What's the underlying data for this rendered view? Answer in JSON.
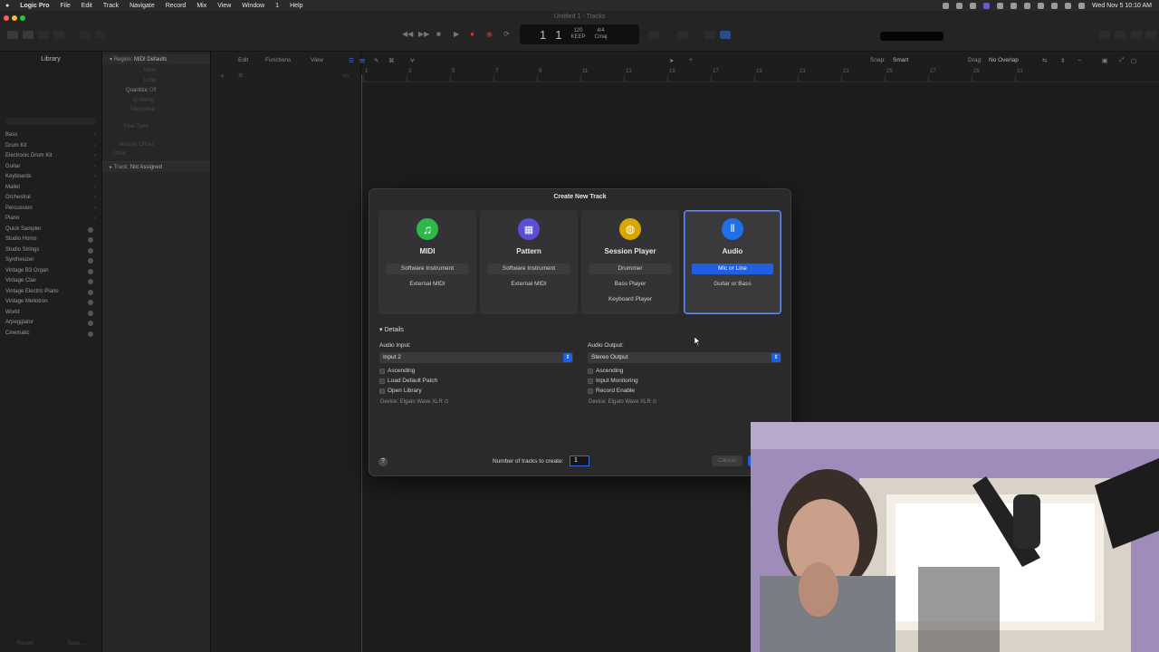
{
  "menubar": {
    "app": "Logic Pro",
    "items": [
      "File",
      "Edit",
      "Track",
      "Navigate",
      "Record",
      "Mix",
      "View",
      "Window",
      "1",
      "Help"
    ],
    "clock": "Wed Nov 5  10:10 AM"
  },
  "window": {
    "title": "Untitled 1 - Tracks"
  },
  "lcd": {
    "bar": "1",
    "beat": "1",
    "tempo": "120",
    "tempo_label": "KEEP",
    "signature": "4/4",
    "key": "Cmaj"
  },
  "library": {
    "title": "Library",
    "items": [
      "Bass",
      "Drum Kit",
      "Electronic Drum Kit",
      "Guitar",
      "Keyboards",
      "Mallet",
      "Orchestral",
      "Percussion",
      "Piano",
      "Quick Sampler",
      "Studio Horns",
      "Studio Strings",
      "Synthesizer",
      "Vintage B3 Organ",
      "Vintage Clav",
      "Vintage Electric Piano",
      "Vintage Mellotron",
      "World",
      "Arpeggiator",
      "Cinematic"
    ],
    "footer": [
      "Revert",
      "Save..."
    ]
  },
  "inspector": {
    "region_label": "Region:",
    "region_value": "MIDI Defaults",
    "rows": [
      "Mute:",
      "Loop:",
      "Quantize",
      "Q-Swing",
      "Transpose:",
      "Fine Tune:",
      "Velocity Offset:",
      "More"
    ],
    "quantize_value": "Off",
    "track_label": "Track:",
    "track_value": "Not Assigned"
  },
  "arrange": {
    "menus": [
      "Edit",
      "Functions",
      "View"
    ],
    "snap_label": "Snap:",
    "snap_value": "Smart",
    "drag_label": "Drag:",
    "drag_value": "No Overlap",
    "ruler": [
      "1",
      "3",
      "5",
      "7",
      "9",
      "11",
      "13",
      "15",
      "17",
      "19",
      "21",
      "23",
      "25",
      "27",
      "29",
      "31"
    ]
  },
  "dialog": {
    "title": "Create New Track",
    "cards": [
      {
        "name": "midi",
        "title": "MIDI",
        "icon": "music-note-icon",
        "color": "#2fb84a",
        "options": [
          "Software Instrument",
          "External MIDI"
        ]
      },
      {
        "name": "pattern",
        "title": "Pattern",
        "icon": "grid-icon",
        "color": "#5a4fd6",
        "options": [
          "Software Instrument",
          "External MIDI"
        ]
      },
      {
        "name": "session-player",
        "title": "Session Player",
        "icon": "drummer-icon",
        "color": "#d8a800",
        "options": [
          "Drummer",
          "Bass Player",
          "Keyboard Player"
        ]
      },
      {
        "name": "audio",
        "title": "Audio",
        "icon": "waveform-icon",
        "color": "#1f6fe8",
        "options": [
          "Mic or Line",
          "Guitar or Bass"
        ]
      }
    ],
    "details_label": "Details",
    "audio_input_label": "Audio Input:",
    "audio_input_value": "Input 2",
    "audio_output_label": "Audio Output:",
    "audio_output_value": "Stereo Output",
    "left_checks": [
      "Ascending",
      "Load Default Patch",
      "Open Library"
    ],
    "right_checks": [
      "Ascending",
      "Input Monitoring",
      "Record Enable"
    ],
    "device_left": "Device: Elgato Wave XLR",
    "device_right": "Device: Elgato Wave XLR",
    "num_tracks_label": "Number of tracks to create:",
    "num_tracks_value": "1",
    "cancel_label": "Cancel",
    "help_label": "?"
  },
  "colors": {
    "accent": "#1f5fe0"
  }
}
